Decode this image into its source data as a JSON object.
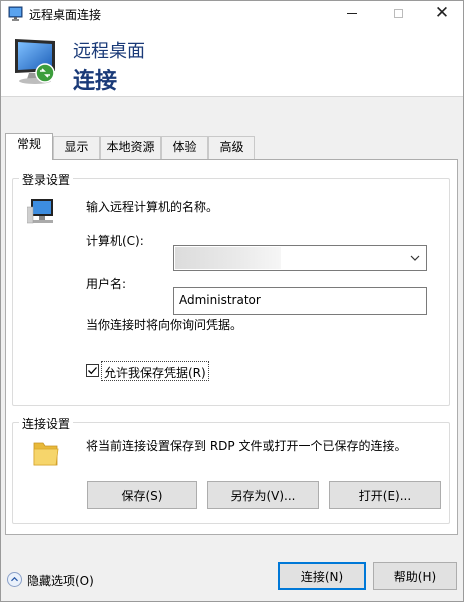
{
  "window": {
    "title": "远程桌面连接",
    "controls": {
      "minimize": "minimize-icon",
      "maximize": "maximize-icon",
      "close": "close-icon"
    }
  },
  "header": {
    "line1": "远程桌面",
    "line2": "连接"
  },
  "tabs": [
    {
      "label": "常规",
      "active": true
    },
    {
      "label": "显示",
      "active": false
    },
    {
      "label": "本地资源",
      "active": false
    },
    {
      "label": "体验",
      "active": false
    },
    {
      "label": "高级",
      "active": false
    }
  ],
  "logon": {
    "group_label": "登录设置",
    "instruction": "输入远程计算机的名称。",
    "computer_label": "计算机(C):",
    "computer_value": "",
    "username_label": "用户名:",
    "username_value": "Administrator",
    "credential_note": "当你连接时将向你询问凭据。",
    "save_credentials_label": "允许我保存凭据(R)",
    "save_credentials_checked": true
  },
  "connection": {
    "group_label": "连接设置",
    "description": "将当前连接设置保存到 RDP 文件或打开一个已保存的连接。",
    "save_button": "保存(S)",
    "save_as_button": "另存为(V)...",
    "open_button": "打开(E)..."
  },
  "footer": {
    "hide_options": "隐藏选项(O)",
    "connect_button": "连接(N)",
    "help_button": "帮助(H)"
  },
  "colors": {
    "accent": "#0078d7",
    "header_text": "#1a3a78",
    "background": "#f0f0f0"
  }
}
